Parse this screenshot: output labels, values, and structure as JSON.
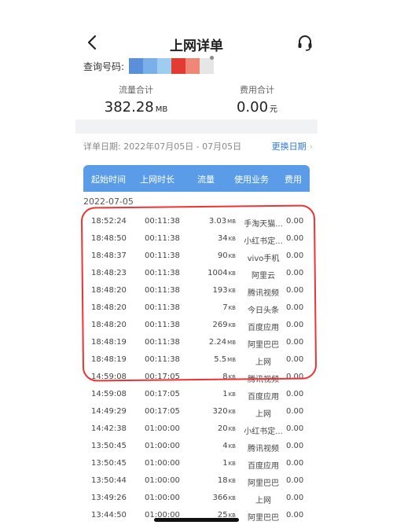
{
  "header": {
    "title": "上网详单"
  },
  "query": {
    "label": "查询号码:",
    "redaction_colors": [
      "#5b8fd9",
      "#7ab0ea",
      "#9fcdf0",
      "#e23b2f",
      "#ef8678",
      "#e6e6e6"
    ]
  },
  "summary": {
    "traffic_label": "流量合计",
    "traffic_value": "382.28",
    "traffic_unit": "MB",
    "fee_label": "费用合计",
    "fee_value": "0.00",
    "fee_unit": "元"
  },
  "date_range": {
    "label": "详单日期: 2022年07月05日 - 07月05日",
    "change_label": "更换日期",
    "change_icon": "chevron-right-icon"
  },
  "table": {
    "headers": [
      "起始时间",
      "上网时长",
      "流量",
      "使用业务",
      "费用"
    ],
    "day": "2022-07-05",
    "header_color": "#5a9ce8",
    "highlight_color": "#e33333",
    "rows": [
      {
        "time": "18:52:24",
        "duration": "00:11:38",
        "amount": "3.03",
        "unit": "MB",
        "service": "手淘天猫...",
        "fee": "0.00"
      },
      {
        "time": "18:48:50",
        "duration": "00:11:38",
        "amount": "34",
        "unit": "KB",
        "service": "小红书定...",
        "fee": "0.00"
      },
      {
        "time": "18:48:37",
        "duration": "00:11:38",
        "amount": "90",
        "unit": "KB",
        "service": "vivo手机",
        "fee": "0.00"
      },
      {
        "time": "18:48:23",
        "duration": "00:11:38",
        "amount": "1004",
        "unit": "KB",
        "service": "阿里云",
        "fee": "0.00"
      },
      {
        "time": "18:48:20",
        "duration": "00:11:38",
        "amount": "193",
        "unit": "KB",
        "service": "腾讯视频",
        "fee": "0.00"
      },
      {
        "time": "18:48:20",
        "duration": "00:11:38",
        "amount": "7",
        "unit": "KB",
        "service": "今日头条",
        "fee": "0.00"
      },
      {
        "time": "18:48:20",
        "duration": "00:11:38",
        "amount": "269",
        "unit": "KB",
        "service": "百度应用",
        "fee": "0.00"
      },
      {
        "time": "18:48:19",
        "duration": "00:11:38",
        "amount": "2.24",
        "unit": "MB",
        "service": "阿里巴巴",
        "fee": "0.00"
      },
      {
        "time": "18:48:19",
        "duration": "00:11:38",
        "amount": "5.5",
        "unit": "MB",
        "service": "上网",
        "fee": "0.00"
      },
      {
        "time": "14:59:08",
        "duration": "00:17:05",
        "amount": "8",
        "unit": "KB",
        "service": "腾讯视频",
        "fee": "0.00"
      },
      {
        "time": "14:59:08",
        "duration": "00:17:05",
        "amount": "1",
        "unit": "KB",
        "service": "百度应用",
        "fee": "0.00"
      },
      {
        "time": "14:49:29",
        "duration": "00:17:05",
        "amount": "320",
        "unit": "KB",
        "service": "上网",
        "fee": "0.00"
      },
      {
        "time": "14:42:38",
        "duration": "01:00:00",
        "amount": "20",
        "unit": "KB",
        "service": "小红书定...",
        "fee": "0.00"
      },
      {
        "time": "13:50:45",
        "duration": "01:00:00",
        "amount": "4",
        "unit": "KB",
        "service": "腾讯视频",
        "fee": "0.00"
      },
      {
        "time": "13:50:45",
        "duration": "01:00:00",
        "amount": "1",
        "unit": "KB",
        "service": "百度应用",
        "fee": "0.00"
      },
      {
        "time": "13:50:44",
        "duration": "01:00:00",
        "amount": "18",
        "unit": "KB",
        "service": "阿里巴巴",
        "fee": "0.00"
      },
      {
        "time": "13:49:26",
        "duration": "01:00:00",
        "amount": "366",
        "unit": "KB",
        "service": "上网",
        "fee": "0.00"
      },
      {
        "time": "13:44:50",
        "duration": "01:00:00",
        "amount": "25",
        "unit": "KB",
        "service": "阿里巴巴",
        "fee": "0.00"
      }
    ]
  }
}
